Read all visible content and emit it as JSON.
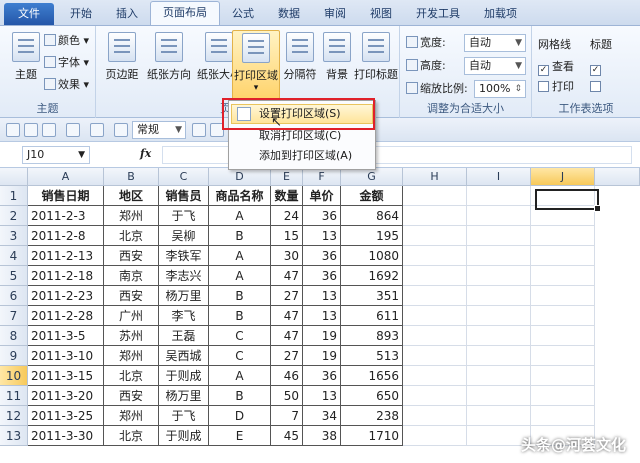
{
  "tabs": [
    "文件",
    "开始",
    "插入",
    "页面布局",
    "公式",
    "数据",
    "审阅",
    "视图",
    "开发工具",
    "加载项"
  ],
  "ribbon": {
    "theme_group": {
      "label": "主题",
      "theme_btn": "主题",
      "colors": "颜色",
      "fonts": "字体",
      "effects": "效果"
    },
    "page_setup": {
      "margins": "页边距",
      "orientation": "纸张方向",
      "size": "纸张大小",
      "print_area": "打印区域",
      "breaks": "分隔符",
      "background": "背景",
      "print_titles": "打印标题",
      "label": "页"
    },
    "scale": {
      "width_label": "宽度:",
      "width_val": "自动",
      "height_label": "高度:",
      "height_val": "自动",
      "scale_label": "缩放比例:",
      "scale_val": "100%",
      "label": "调整为合适大小"
    },
    "sheet_options": {
      "gridlines": "网格线",
      "headings": "标题",
      "view": "查看",
      "print": "打印",
      "label": "工作表选项"
    }
  },
  "qat": {
    "style_value": "常规"
  },
  "formula_bar": {
    "name_box": "J10",
    "fx": "fx"
  },
  "print_area_menu": {
    "items": [
      "设置打印区域(S)",
      "取消打印区域(C)",
      "添加到打印区域(A)"
    ],
    "highlighted": 0
  },
  "columns": [
    "A",
    "B",
    "C",
    "D",
    "E",
    "F",
    "G",
    "H",
    "I",
    "J"
  ],
  "selected_column": "J",
  "selected_row": 10,
  "table": {
    "headers": [
      "销售日期",
      "地区",
      "销售员",
      "商品名称",
      "数量",
      "单价",
      "金额"
    ],
    "rows": [
      [
        "2011-2-3",
        "郑州",
        "于飞",
        "A",
        "24",
        "36",
        "864"
      ],
      [
        "2011-2-8",
        "北京",
        "吴柳",
        "B",
        "15",
        "13",
        "195"
      ],
      [
        "2011-2-13",
        "西安",
        "李铁军",
        "A",
        "30",
        "36",
        "1080"
      ],
      [
        "2011-2-18",
        "南京",
        "李志兴",
        "A",
        "47",
        "36",
        "1692"
      ],
      [
        "2011-2-23",
        "西安",
        "杨万里",
        "B",
        "27",
        "13",
        "351"
      ],
      [
        "2011-2-28",
        "广州",
        "李飞",
        "B",
        "47",
        "13",
        "611"
      ],
      [
        "2011-3-5",
        "苏州",
        "王磊",
        "C",
        "47",
        "19",
        "893"
      ],
      [
        "2011-3-10",
        "郑州",
        "吴西城",
        "C",
        "27",
        "19",
        "513"
      ],
      [
        "2011-3-15",
        "北京",
        "于则成",
        "A",
        "46",
        "36",
        "1656"
      ],
      [
        "2011-3-20",
        "西安",
        "杨万里",
        "B",
        "50",
        "13",
        "650"
      ],
      [
        "2011-3-25",
        "郑州",
        "于飞",
        "D",
        "7",
        "34",
        "238"
      ],
      [
        "2011-3-30",
        "北京",
        "于则成",
        "E",
        "45",
        "38",
        "1710"
      ]
    ]
  },
  "watermark": "头条@河荟文化"
}
